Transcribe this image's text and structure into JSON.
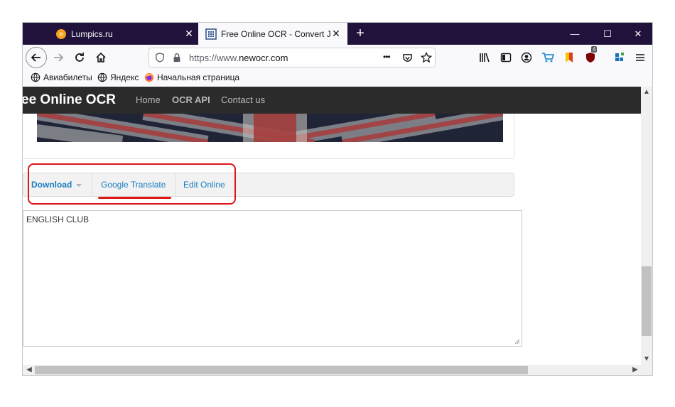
{
  "browser": {
    "tabs": [
      {
        "title": "Lumpics.ru",
        "close": "✕"
      },
      {
        "title": "Free Online OCR - Convert JPEG",
        "close": "✕"
      }
    ],
    "new_tab": "+",
    "window_controls": {
      "minimize": "—",
      "maximize": "☐",
      "close": "✕"
    },
    "url_prefix": "https://www.",
    "url_domain": "newocr.com",
    "url_more": "•••",
    "ublock_badge": "4",
    "bookmarks": [
      "Авиабилеты",
      "Яндекс",
      "Начальная страница"
    ]
  },
  "site": {
    "brand": "ee Online OCR",
    "nav": [
      "Home",
      "OCR API",
      "Contact us"
    ]
  },
  "toolbar": {
    "download": "Download",
    "google_translate": "Google Translate",
    "edit_online": "Edit Online"
  },
  "result": {
    "text": "ENGLISH CLUB"
  },
  "colors": {
    "tabstrip": "#20123a",
    "accent_link": "#1a7ec1",
    "highlight_red": "#e01616"
  },
  "icons": [
    "back-arrow-icon",
    "forward-arrow-icon",
    "reload-icon",
    "home-icon",
    "shield-icon",
    "lock-icon",
    "pocket-icon",
    "star-icon",
    "library-icon",
    "sidebar-icon",
    "account-icon",
    "cart-icon",
    "bookmark-icon",
    "ublock-icon",
    "extension-icon",
    "menu-icon",
    "globe-icon",
    "firefox-icon"
  ]
}
